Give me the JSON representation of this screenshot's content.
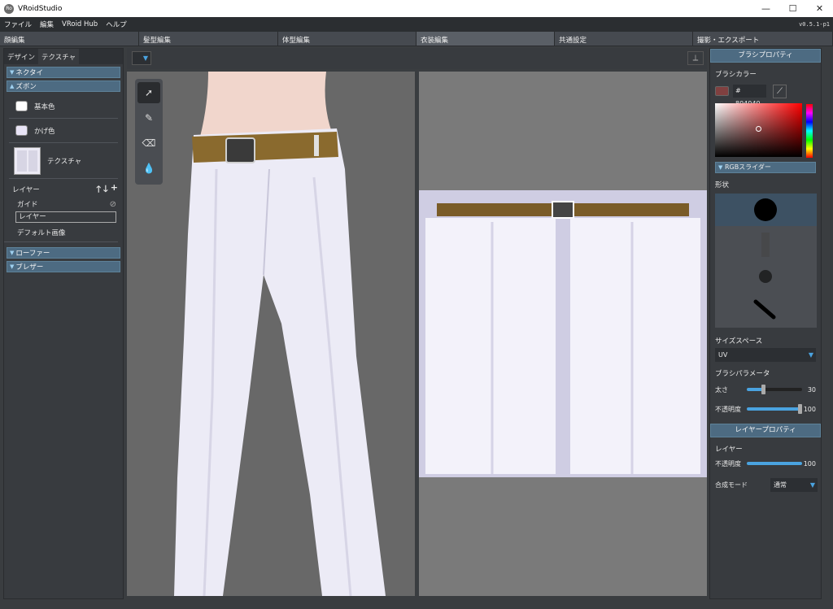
{
  "window": {
    "title": "VRoidStudio",
    "logo_text": "Ro",
    "minimize": "—",
    "maximize": "☐",
    "close": "✕"
  },
  "menu": {
    "items": [
      "ファイル",
      "編集",
      "VRoid Hub",
      "ヘルプ"
    ],
    "version": "v0.5.1-p1"
  },
  "mode_tabs": [
    "顔編集",
    "髪型編集",
    "体型編集",
    "衣装編集",
    "共通設定",
    "撮影・エクスポート"
  ],
  "left_panel": {
    "tabs": [
      "デザイン",
      "テクスチャ"
    ],
    "sections": [
      {
        "label": "ネクタイ",
        "expanded": false
      },
      {
        "label": "ズボン",
        "expanded": true
      },
      {
        "label": "ローファー",
        "expanded": false
      },
      {
        "label": "ブレザー",
        "expanded": false
      }
    ],
    "base_color_label": "基本色",
    "shade_color_label": "かげ色",
    "texture_label": "テクスチャ",
    "layer_header": "レイヤー",
    "layer_items": [
      "ガイド",
      "レイヤー",
      "デフォルト画像"
    ],
    "colors": {
      "base": "#ffffff",
      "shade": "#e8e4f6"
    }
  },
  "viewport": {
    "dropdown_caret": "▼",
    "symmetry": "⟂"
  },
  "right_panel": {
    "brush_header": "ブラシプロパティ",
    "brush_color_label": "ブラシカラー",
    "hex_prefix": "#",
    "hex_value": "804040",
    "rgb_slider_label": "RGBスライダー",
    "shape_label": "形状",
    "size_space_label": "サイズスペース",
    "size_space_value": "UV",
    "brush_param_label": "ブラシパラメータ",
    "thickness_label": "太さ",
    "thickness_value": "30",
    "opacity_label": "不透明度",
    "opacity_value": "100",
    "layer_header": "レイヤープロパティ",
    "layer_label": "レイヤー",
    "layer_opacity_label": "不透明度",
    "layer_opacity_value": "100",
    "blend_label": "合成モード",
    "blend_value": "通常",
    "accent": "#4aa3e0"
  }
}
